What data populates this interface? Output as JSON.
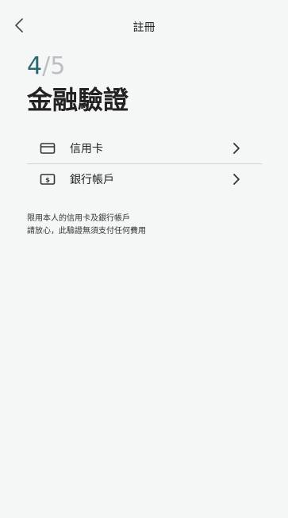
{
  "header": {
    "title": "註冊",
    "back_icon": "chevron-left-icon"
  },
  "step": {
    "current": "4",
    "separator": "/",
    "total": "5"
  },
  "page_title": "金融驗證",
  "options": [
    {
      "label": "信用卡",
      "icon": "credit-card-icon"
    },
    {
      "label": "銀行帳戶",
      "icon": "bank-note-icon"
    }
  ],
  "notes": [
    "限用本人的信用卡及銀行帳戶",
    "請放心，此驗證無須支付任何費用"
  ],
  "colors": {
    "background": "#f5f7f7",
    "accent": "#2a6870",
    "step_muted": "#b9c0c3",
    "divider": "#cdd3d5"
  }
}
